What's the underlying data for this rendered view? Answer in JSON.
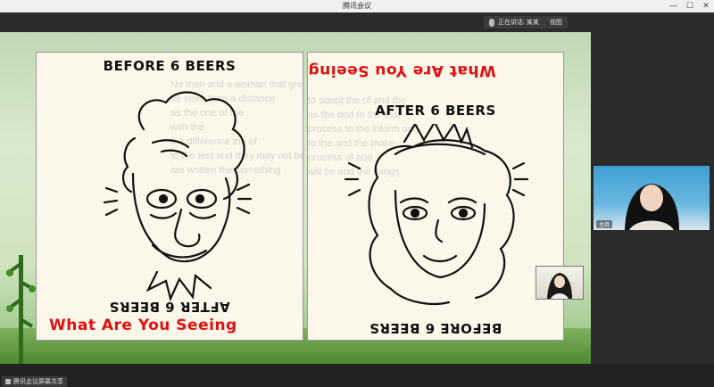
{
  "window": {
    "title": "腾讯会议",
    "controls": {
      "minimize": "—",
      "maximize": "☐",
      "close": "✕"
    }
  },
  "header": {
    "speaker_name": "正在讲话: 某某",
    "view_label": "视图"
  },
  "slide": {
    "left_panel": {
      "top_text": "BEFORE 6 BEERS",
      "bottom_text_upside_down": "AFTER 6 BEERS",
      "caption": "What Are You Seeing"
    },
    "right_panel": {
      "top_text_upside_down": "What Are You Seeing",
      "heading": "AFTER 6 BEERS",
      "bottom_text_upside_down": "BEFORE 6 BEERS"
    }
  },
  "video": {
    "main_label": "主持"
  },
  "footer": {
    "status_text": "腾讯会议屏幕共享"
  },
  "colors": {
    "caption_red": "#e01010",
    "panel_bg": "#fbf8ea",
    "dark_chrome": "#2b2b2b"
  }
}
